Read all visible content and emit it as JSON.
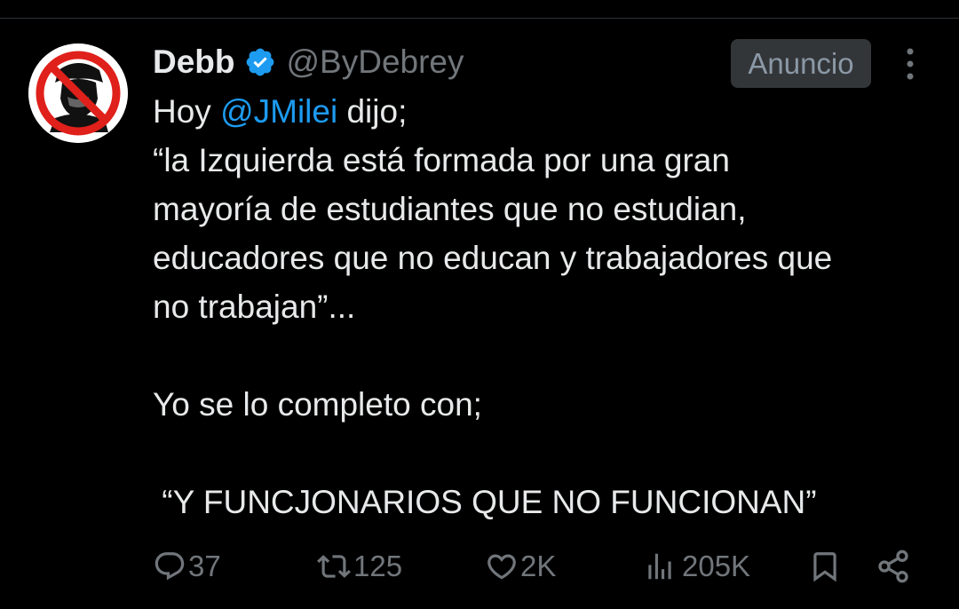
{
  "tweet": {
    "author": {
      "name": "Debb",
      "handle": "@ByDebrey",
      "verified": true,
      "verified_color": "#1d9bf0",
      "avatar_icon": "prohibited-portrait-icon"
    },
    "ad_badge": "Anuncio",
    "more_icon": "more-vertical-icon",
    "text": {
      "line1_prefix": "Hoy ",
      "mention": "@JMilei",
      "line1_suffix": " dijo;",
      "line2": "“la Izquierda está formada por una gran",
      "line3": "mayoría de estudiantes que no estudian,",
      "line4": "educadores que no educan y trabajadores que",
      "line5": "no trabajan”...",
      "line6": "Yo se lo completo con;",
      "line7": " “Y FUNCJONARIOS QUE NO FUNCIONAN”"
    },
    "actions": {
      "replies": {
        "icon": "reply-icon",
        "count": "37"
      },
      "reposts": {
        "icon": "repost-icon",
        "count": "125"
      },
      "likes": {
        "icon": "heart-icon",
        "count": "2K"
      },
      "views": {
        "icon": "views-icon",
        "count": "205K"
      },
      "bookmark": {
        "icon": "bookmark-icon"
      },
      "share": {
        "icon": "share-icon"
      }
    },
    "colors": {
      "background": "#000000",
      "text": "#e7e9ea",
      "secondary": "#71767b",
      "link": "#1d9bf0"
    }
  }
}
